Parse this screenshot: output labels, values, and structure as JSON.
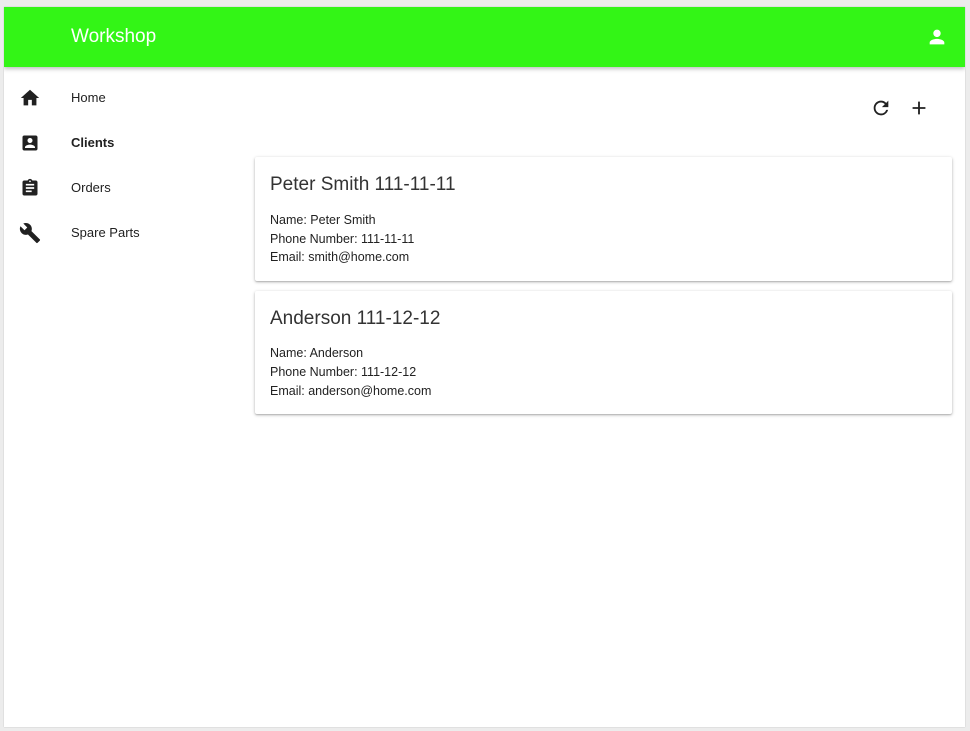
{
  "app": {
    "title": "Workshop",
    "accent_color": "#33f516",
    "account_icon": "account-icon"
  },
  "sidebar": {
    "items": [
      {
        "label": "Home",
        "icon": "home-icon",
        "active": false
      },
      {
        "label": "Clients",
        "icon": "contact-card-icon",
        "active": true
      },
      {
        "label": "Orders",
        "icon": "clipboard-icon",
        "active": false
      },
      {
        "label": "Spare Parts",
        "icon": "wrench-icon",
        "active": false
      }
    ]
  },
  "toolbar": {
    "refresh_icon": "refresh-icon",
    "add_icon": "plus-icon"
  },
  "clients": [
    {
      "title": "Peter Smith 111-11-11",
      "name_line": "Name: Peter Smith",
      "phone_line": "Phone Number: 111-11-11",
      "email_line": "Email: smith@home.com"
    },
    {
      "title": "Anderson 111-12-12",
      "name_line": "Name: Anderson",
      "phone_line": "Phone Number: 111-12-12",
      "email_line": "Email: anderson@home.com"
    }
  ]
}
